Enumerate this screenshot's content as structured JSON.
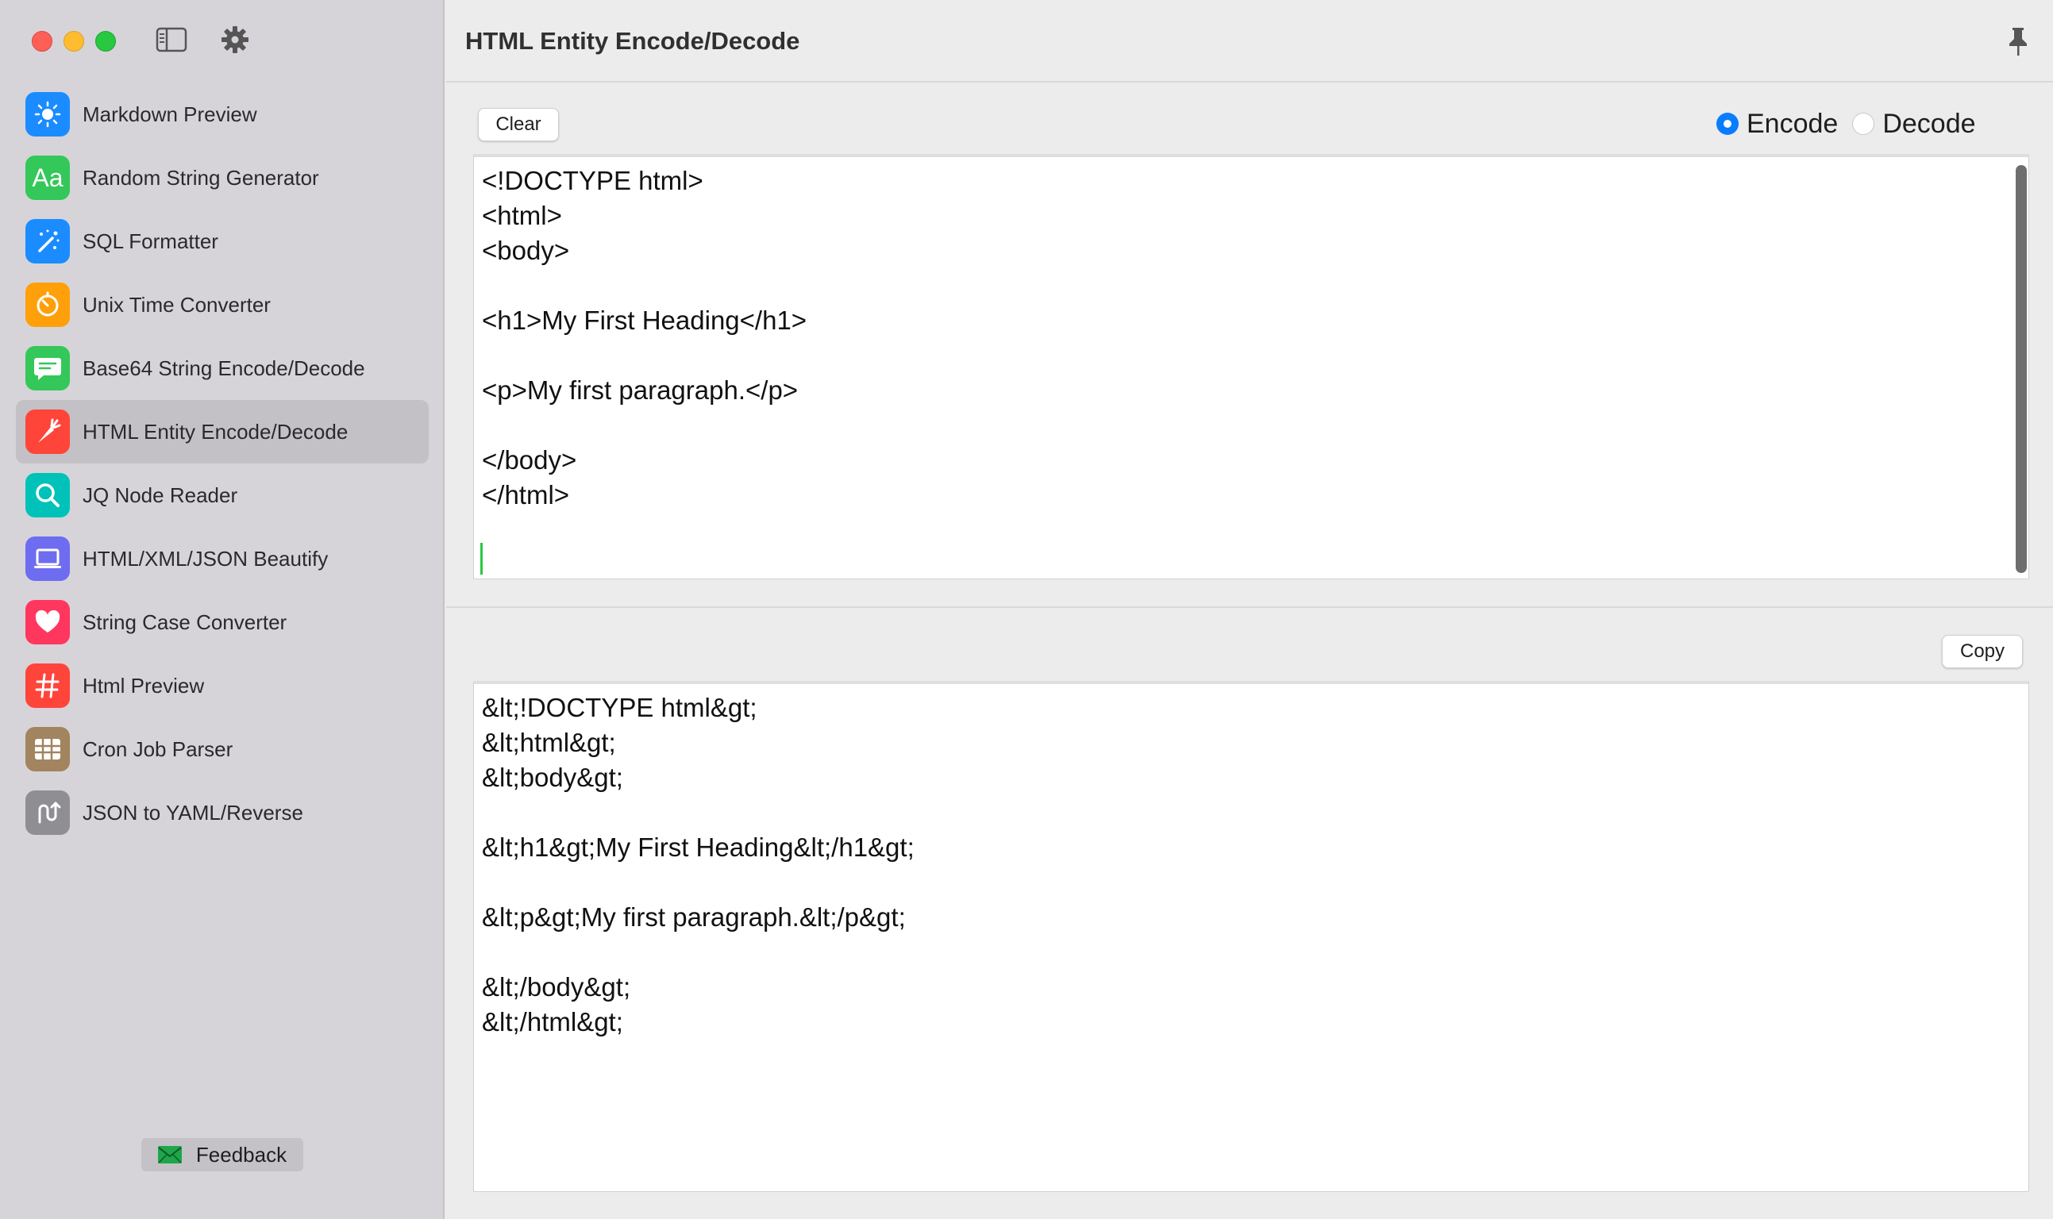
{
  "window": {
    "title": "HTML Entity Encode/Decode"
  },
  "sidebar": {
    "items": [
      {
        "label": "Markdown Preview",
        "icon": "sun-icon",
        "color": "#1a8cff"
      },
      {
        "label": "Random String Generator",
        "icon": "text-aa-icon",
        "color": "#34c759"
      },
      {
        "label": "SQL Formatter",
        "icon": "magic-wand-icon",
        "color": "#1a8cff"
      },
      {
        "label": "Unix Time Converter",
        "icon": "timer-icon",
        "color": "#ff9f0a"
      },
      {
        "label": "Base64 String Encode/Decode",
        "icon": "message-icon",
        "color": "#34c759"
      },
      {
        "label": "HTML Entity Encode/Decode",
        "icon": "carrot-icon",
        "color": "#ff453a",
        "selected": true
      },
      {
        "label": "JQ Node Reader",
        "icon": "magnifier-icon",
        "color": "#00c2b8"
      },
      {
        "label": "HTML/XML/JSON Beautify",
        "icon": "laptop-icon",
        "color": "#6e6cf0"
      },
      {
        "label": "String Case Converter",
        "icon": "heart-icon",
        "color": "#ff375f"
      },
      {
        "label": "Html Preview",
        "icon": "hash-icon",
        "color": "#ff453a"
      },
      {
        "label": "Cron Job Parser",
        "icon": "grid-icon",
        "color": "#a2845e"
      },
      {
        "label": "JSON to YAML/Reverse",
        "icon": "arrows-icon",
        "color": "#8e8e93"
      }
    ],
    "feedback_label": "Feedback"
  },
  "toolbar": {
    "clear_label": "Clear",
    "copy_label": "Copy"
  },
  "mode": {
    "options": [
      "Encode",
      "Decode"
    ],
    "selected": "Encode"
  },
  "input": {
    "text": "<!DOCTYPE html>\n<html>\n<body>\n\n<h1>My First Heading</h1>\n\n<p>My first paragraph.</p>\n\n</body>\n</html>\n\n"
  },
  "output": {
    "text": "&lt;!DOCTYPE html&gt;\n&lt;html&gt;\n&lt;body&gt;\n\n&lt;h1&gt;My First Heading&lt;/h1&gt;\n\n&lt;p&gt;My first paragraph.&lt;/p&gt;\n\n&lt;/body&gt;\n&lt;/html&gt;"
  },
  "colors": {
    "accent": "#0a7cff",
    "caret": "#28c840"
  }
}
